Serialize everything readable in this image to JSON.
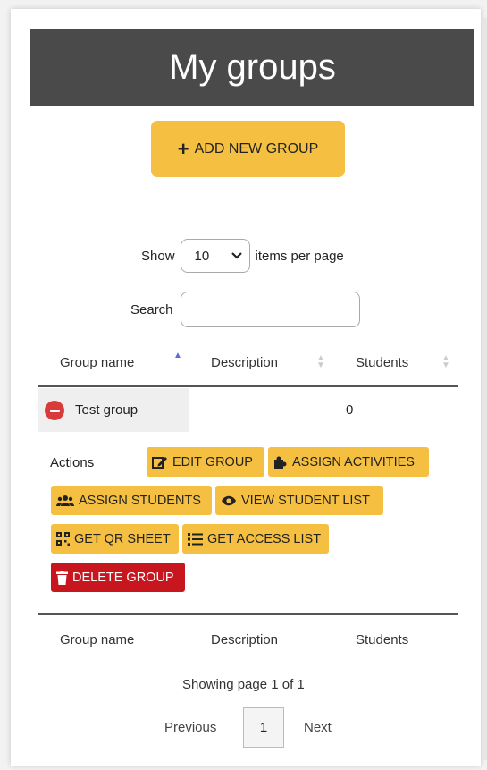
{
  "page": {
    "title": "My groups"
  },
  "toolbar": {
    "add_label": "ADD NEW GROUP"
  },
  "pagesize": {
    "show_label": "Show",
    "value": "10",
    "suffix": "items per page"
  },
  "search": {
    "label": "Search",
    "value": "",
    "placeholder": ""
  },
  "table": {
    "columns": [
      "Group name",
      "Description",
      "Students"
    ],
    "rows": [
      {
        "name": "Test group",
        "description": "",
        "students": "0"
      }
    ]
  },
  "actions": {
    "label": "Actions",
    "edit_group": "EDIT GROUP",
    "assign_activities": "ASSIGN ACTIVITIES",
    "assign_students": "ASSIGN STUDENTS",
    "view_student_list": "VIEW STUDENT LIST",
    "get_qr_sheet": "GET QR SHEET",
    "get_access_list": "GET ACCESS LIST",
    "delete_group": "DELETE GROUP"
  },
  "pagination": {
    "info": "Showing page 1 of 1",
    "previous": "Previous",
    "current": "1",
    "next": "Next"
  },
  "colors": {
    "accent": "#f5c041",
    "danger": "#c8161e",
    "header_bg": "#4a4a4a"
  }
}
